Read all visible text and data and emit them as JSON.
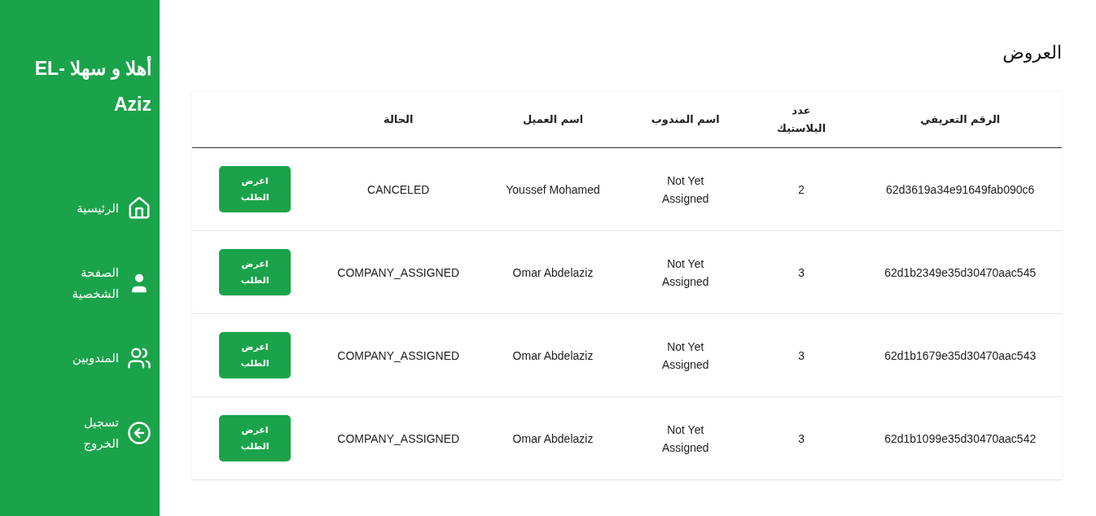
{
  "sidebar": {
    "greeting": "أهلا و سهلا EL-Aziz",
    "items": [
      {
        "kind": "home",
        "label": "الرئيسية"
      },
      {
        "kind": "profile",
        "label": "الصفحة الشخصية"
      },
      {
        "kind": "agents",
        "label": "المندوبين"
      },
      {
        "kind": "logout",
        "label": "تسجيل الخروج"
      }
    ]
  },
  "page_title": "العروض",
  "table": {
    "columns": [
      "الرقم التعريفي",
      "عدد البلاستيك",
      "اسم المندوب",
      "اسم العميل",
      "الحالة"
    ],
    "rows": [
      {
        "id": "62d3619a34e91649fab090c6",
        "count": "2",
        "agent": "Not Yet Assigned",
        "customer": "Youssef Mohamed",
        "status": "CANCELED",
        "action": "اعرض الطلب"
      },
      {
        "id": "62d1b2349e35d30470aac545",
        "count": "3",
        "agent": "Not Yet Assigned",
        "customer": "Omar Abdelaziz",
        "status": "COMPANY_ASSIGNED",
        "action": "اعرض الطلب"
      },
      {
        "id": "62d1b1679e35d30470aac543",
        "count": "3",
        "agent": "Not Yet Assigned",
        "customer": "Omar Abdelaziz",
        "status": "COMPANY_ASSIGNED",
        "action": "اعرض الطلب"
      },
      {
        "id": "62d1b1099e35d30470aac542",
        "count": "3",
        "agent": "Not Yet Assigned",
        "customer": "Omar Abdelaziz",
        "status": "COMPANY_ASSIGNED",
        "action": "اعرض الطلب"
      }
    ]
  }
}
